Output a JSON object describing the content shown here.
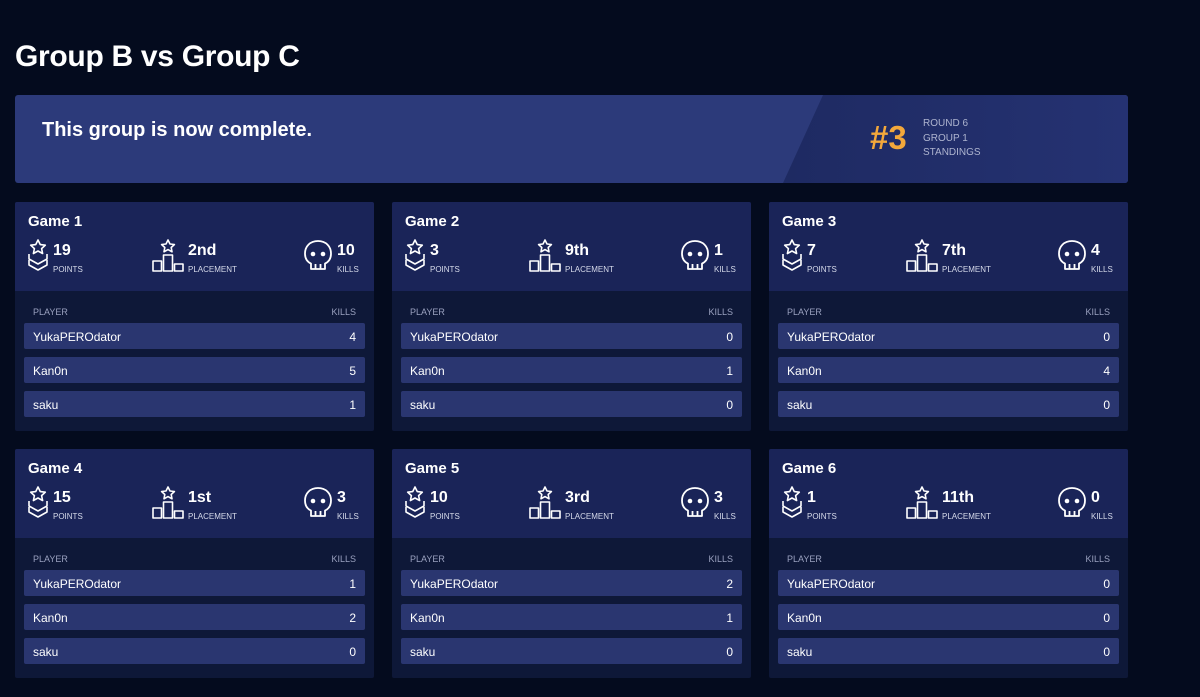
{
  "page": {
    "title": "Group B vs Group C"
  },
  "banner": {
    "message": "This group is now complete.",
    "rank": "#3",
    "lines": [
      "ROUND 6",
      "GROUP 1",
      "STANDINGS"
    ]
  },
  "colors": {
    "background": "#040b1e",
    "banner": "#2c3a7a",
    "card_header": "#1a2458",
    "row": "#2a3670",
    "accent_rank": "#f3a83b"
  },
  "labels": {
    "points": "POINTS",
    "placement": "PLACEMENT",
    "kills": "KILLS",
    "col_player": "PLAYER",
    "col_kills": "KILLS"
  },
  "icons": {
    "points": "chevron-star-icon",
    "placement": "podium-icon",
    "kills": "skull-icon"
  },
  "games": [
    {
      "title": "Game 1",
      "points": "19",
      "placement": "2nd",
      "kills": "10",
      "players": [
        {
          "name": "YukaPEROdator",
          "kills": "4"
        },
        {
          "name": "Kan0n",
          "kills": "5"
        },
        {
          "name": "saku",
          "kills": "1"
        }
      ]
    },
    {
      "title": "Game 2",
      "points": "3",
      "placement": "9th",
      "kills": "1",
      "players": [
        {
          "name": "YukaPEROdator",
          "kills": "0"
        },
        {
          "name": "Kan0n",
          "kills": "1"
        },
        {
          "name": "saku",
          "kills": "0"
        }
      ]
    },
    {
      "title": "Game 3",
      "points": "7",
      "placement": "7th",
      "kills": "4",
      "players": [
        {
          "name": "YukaPEROdator",
          "kills": "0"
        },
        {
          "name": "Kan0n",
          "kills": "4"
        },
        {
          "name": "saku",
          "kills": "0"
        }
      ]
    },
    {
      "title": "Game 4",
      "points": "15",
      "placement": "1st",
      "kills": "3",
      "players": [
        {
          "name": "YukaPEROdator",
          "kills": "1"
        },
        {
          "name": "Kan0n",
          "kills": "2"
        },
        {
          "name": "saku",
          "kills": "0"
        }
      ]
    },
    {
      "title": "Game 5",
      "points": "10",
      "placement": "3rd",
      "kills": "3",
      "players": [
        {
          "name": "YukaPEROdator",
          "kills": "2"
        },
        {
          "name": "Kan0n",
          "kills": "1"
        },
        {
          "name": "saku",
          "kills": "0"
        }
      ]
    },
    {
      "title": "Game 6",
      "points": "1",
      "placement": "11th",
      "kills": "0",
      "players": [
        {
          "name": "YukaPEROdator",
          "kills": "0"
        },
        {
          "name": "Kan0n",
          "kills": "0"
        },
        {
          "name": "saku",
          "kills": "0"
        }
      ]
    }
  ]
}
